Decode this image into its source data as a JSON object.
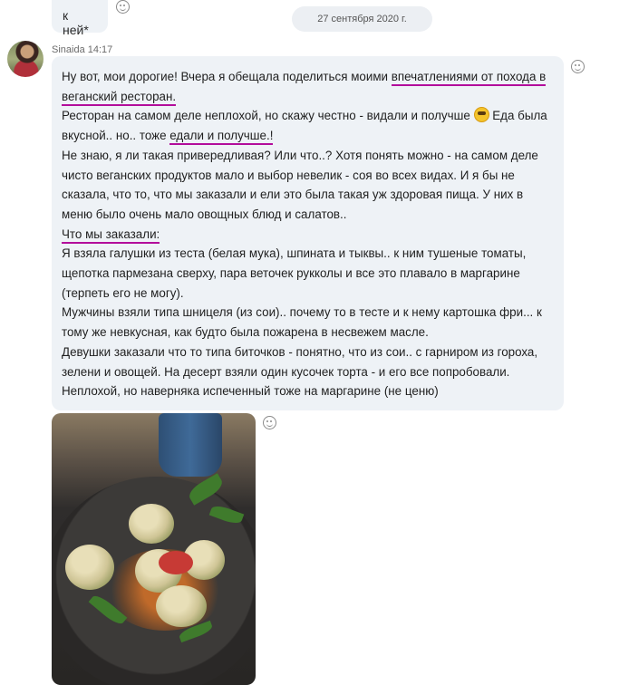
{
  "previous_message": {
    "text": "к ней*"
  },
  "date_separator": "27 сентября 2020 г.",
  "message": {
    "sender": "Sinaida",
    "time": "14:17",
    "lines": [
      {
        "a": "Ну вот, мои дорогие! Вчера я обещала поделиться моими ",
        "u": "впечатлениями от похода в"
      },
      {
        "u": "веганский ресторан."
      },
      {
        "a": "Ресторан на самом деле неплохой, но скажу честно - видали и получше ",
        "emoji": true,
        "b": "  Еда была"
      },
      {
        "a": "вкусной.. но.. тоже ",
        "u": "едали и получше.!"
      },
      {
        "a": "Не знаю, я ли такая привередливая? Или что..? Хотя понять можно - на самом деле"
      },
      {
        "a": "чисто веганских продуктов мало и выбор невелик - соя во всех видах. И я бы не"
      },
      {
        "a": "сказала, что то, что мы заказали и ели это была такая уж здоровая пища. У них в"
      },
      {
        "a": "меню было очень мало овощных блюд и салатов.."
      },
      {
        "u": "Что мы заказали:"
      },
      {
        "a": "Я взяла галушки из теста (белая мука), шпината и тыквы.. к ним тушеные томаты,"
      },
      {
        "a": "щепотка пармезана сверху, пара веточек рукколы и все это плавало в маргарине"
      },
      {
        "a": "(терпеть его не могу)."
      },
      {
        "a": "Мужчины взяли типа шницеля (из сои).. почему то в тесте и к нему картошка фри... к"
      },
      {
        "a": "тому же невкусная, как будто была пожарена в несвежем масле."
      },
      {
        "a": "Девушки заказали что то типа биточков - понятно, что из сои.. с гарниром из гороха,"
      },
      {
        "a": "зелени и овощей. На десерт взяли один кусочек торта - и его все попробовали."
      },
      {
        "a": "Неплохой, но наверняка испеченный тоже на маргарине (не ценю)"
      }
    ]
  },
  "colors": {
    "bubble_bg": "#eef2f6",
    "underline": "#b30d9b"
  },
  "icons": [
    "reaction-smiley-icon",
    "laughing-emoji-icon"
  ]
}
